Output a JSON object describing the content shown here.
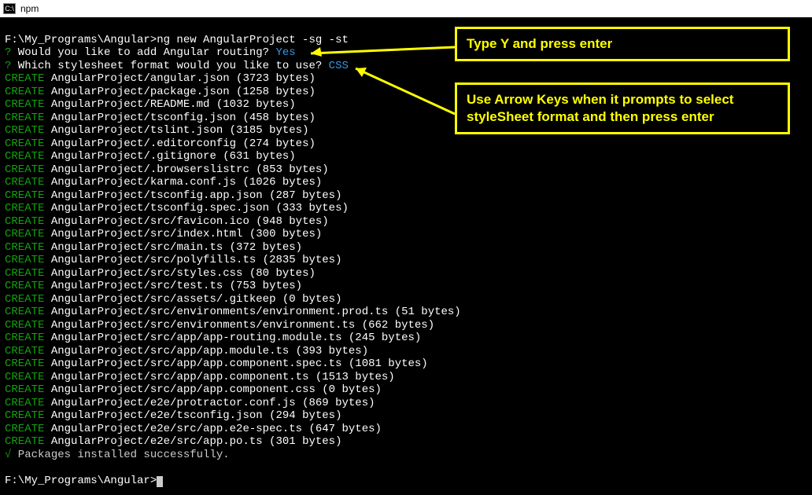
{
  "window": {
    "title": "npm",
    "icon_label": "C:\\"
  },
  "prompt": {
    "path": "F:\\My_Programs\\Angular>",
    "command": "ng new AngularProject -sg -st"
  },
  "q1": {
    "mark": "?",
    "text": "Would you like to add Angular routing?",
    "answer": "Yes"
  },
  "q2": {
    "mark": "?",
    "text": "Which stylesheet format would you like to use?",
    "answer": "CSS"
  },
  "create_label": "CREATE",
  "files": [
    "AngularProject/angular.json (3723 bytes)",
    "AngularProject/package.json (1258 bytes)",
    "AngularProject/README.md (1032 bytes)",
    "AngularProject/tsconfig.json (458 bytes)",
    "AngularProject/tslint.json (3185 bytes)",
    "AngularProject/.editorconfig (274 bytes)",
    "AngularProject/.gitignore (631 bytes)",
    "AngularProject/.browserslistrc (853 bytes)",
    "AngularProject/karma.conf.js (1026 bytes)",
    "AngularProject/tsconfig.app.json (287 bytes)",
    "AngularProject/tsconfig.spec.json (333 bytes)",
    "AngularProject/src/favicon.ico (948 bytes)",
    "AngularProject/src/index.html (300 bytes)",
    "AngularProject/src/main.ts (372 bytes)",
    "AngularProject/src/polyfills.ts (2835 bytes)",
    "AngularProject/src/styles.css (80 bytes)",
    "AngularProject/src/test.ts (753 bytes)",
    "AngularProject/src/assets/.gitkeep (0 bytes)",
    "AngularProject/src/environments/environment.prod.ts (51 bytes)",
    "AngularProject/src/environments/environment.ts (662 bytes)",
    "AngularProject/src/app/app-routing.module.ts (245 bytes)",
    "AngularProject/src/app/app.module.ts (393 bytes)",
    "AngularProject/src/app/app.component.spec.ts (1081 bytes)",
    "AngularProject/src/app/app.component.ts (1513 bytes)",
    "AngularProject/src/app/app.component.css (0 bytes)",
    "AngularProject/e2e/protractor.conf.js (869 bytes)",
    "AngularProject/e2e/tsconfig.json (294 bytes)",
    "AngularProject/e2e/src/app.e2e-spec.ts (647 bytes)",
    "AngularProject/e2e/src/app.po.ts (301 bytes)"
  ],
  "success": {
    "mark": "√",
    "text": "Packages installed successfully."
  },
  "prompt2": "F:\\My_Programs\\Angular>",
  "callout1": "Type Y and press enter",
  "callout2": "Use Arrow Keys when it prompts to select styleSheet format and then press enter"
}
